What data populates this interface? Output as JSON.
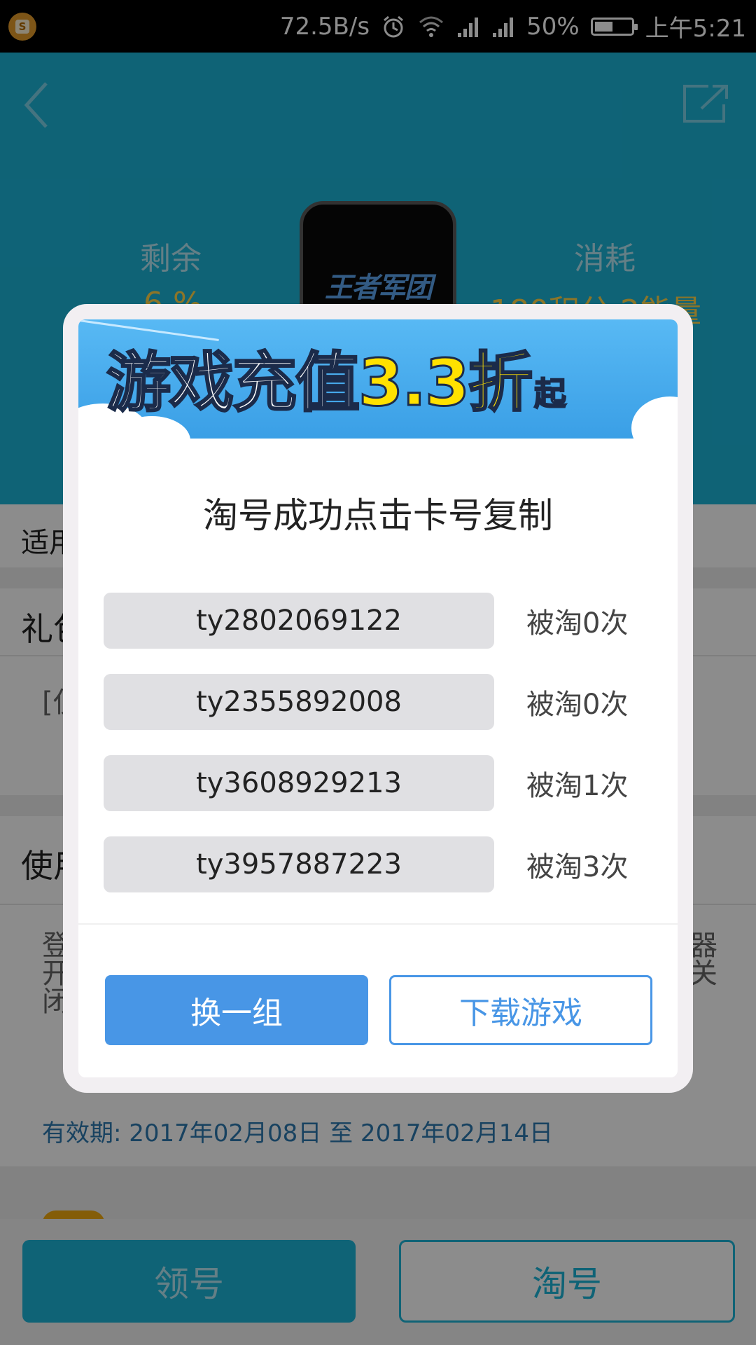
{
  "status_bar": {
    "speed": "72.5B/s",
    "battery_percent": "50%",
    "battery_level": 0.5,
    "time": "上午5:21",
    "icons": [
      "app-notification-icon",
      "alarm-icon",
      "wifi-icon",
      "signal-icon",
      "signal-icon",
      "battery-icon"
    ]
  },
  "header": {
    "back_icon": "back-icon",
    "share_icon": "share-icon",
    "remaining_label": "剩余",
    "remaining_value": "6 %",
    "cost_label": "消耗",
    "cost_value": "180积分  2能量",
    "game_logo_text": "王者军团"
  },
  "background": {
    "applicable_label": "适用",
    "gift_label": "礼包",
    "gift_text": "[仅",
    "usage_label": "使用",
    "usage_text_lines": [
      "登",
      "开",
      "闭"
    ],
    "usage_right_lines": [
      "器",
      "关"
    ],
    "validity": "有效期: 2017年02月08日 至 2017年02月14日"
  },
  "dialog": {
    "banner": {
      "part1": "游戏充值",
      "part2": "3.3折",
      "part3": "起"
    },
    "title": "淘号成功点击卡号复制",
    "codes": [
      {
        "code": "ty2802069122",
        "count": "被淘0次"
      },
      {
        "code": "ty2355892008",
        "count": "被淘0次"
      },
      {
        "code": "ty3608929213",
        "count": "被淘1次"
      },
      {
        "code": "ty3957887223",
        "count": "被淘3次"
      }
    ],
    "swap_button": "换一组",
    "download_button": "下载游戏"
  },
  "bottom": {
    "claim_button": "领号",
    "tao_button": "淘号"
  },
  "colors": {
    "header_teal": "#1cb4d8",
    "accent_blue": "#4896e6",
    "highlight_yellow": "#ffd54a"
  }
}
